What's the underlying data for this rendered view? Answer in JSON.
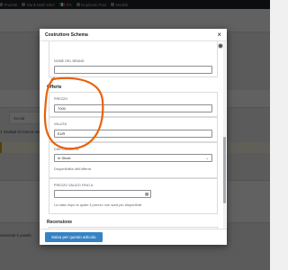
{
  "adminbar": {
    "items": [
      {
        "label": "Prodotti",
        "icon": "box-icon"
      },
      {
        "label": "Rank Math SEO",
        "icon": "rankmath-icon"
      },
      {
        "label": "ITA",
        "icon": "italy-flag-icon"
      },
      {
        "label": "Duplicate Post",
        "icon": "duplicate-icon"
      },
      {
        "label": "Modelli",
        "icon": "template-icon"
      }
    ]
  },
  "background": {
    "link_label": "Social",
    "text": "1 risultati di ricerca vis",
    "bottom_text": "ivamente è possib"
  },
  "modal": {
    "title": "Costruttore Schema",
    "close": "×",
    "brand": {
      "label": "NOME DEL BRAND",
      "value": ""
    },
    "offers_section": "Offerte",
    "price": {
      "label": "PREZZO",
      "value": "7000"
    },
    "currency": {
      "label": "VALUTA",
      "value": "EUR"
    },
    "availability": {
      "label": "DISPONIBILITÀ",
      "value": "In Stock",
      "help": "Disponibilità dell'offerta"
    },
    "price_valid_until": {
      "label": "PREZZO VALIDO FINO A",
      "value": "",
      "help": "La data dopo la quale il prezzo non sarà più disponibile"
    },
    "review_section": "Recensione",
    "save_button": "Salva per questo articolo"
  },
  "colors": {
    "accent": "#3582c4",
    "annotation": "#e8620a",
    "adminbar": "#1d2327"
  }
}
